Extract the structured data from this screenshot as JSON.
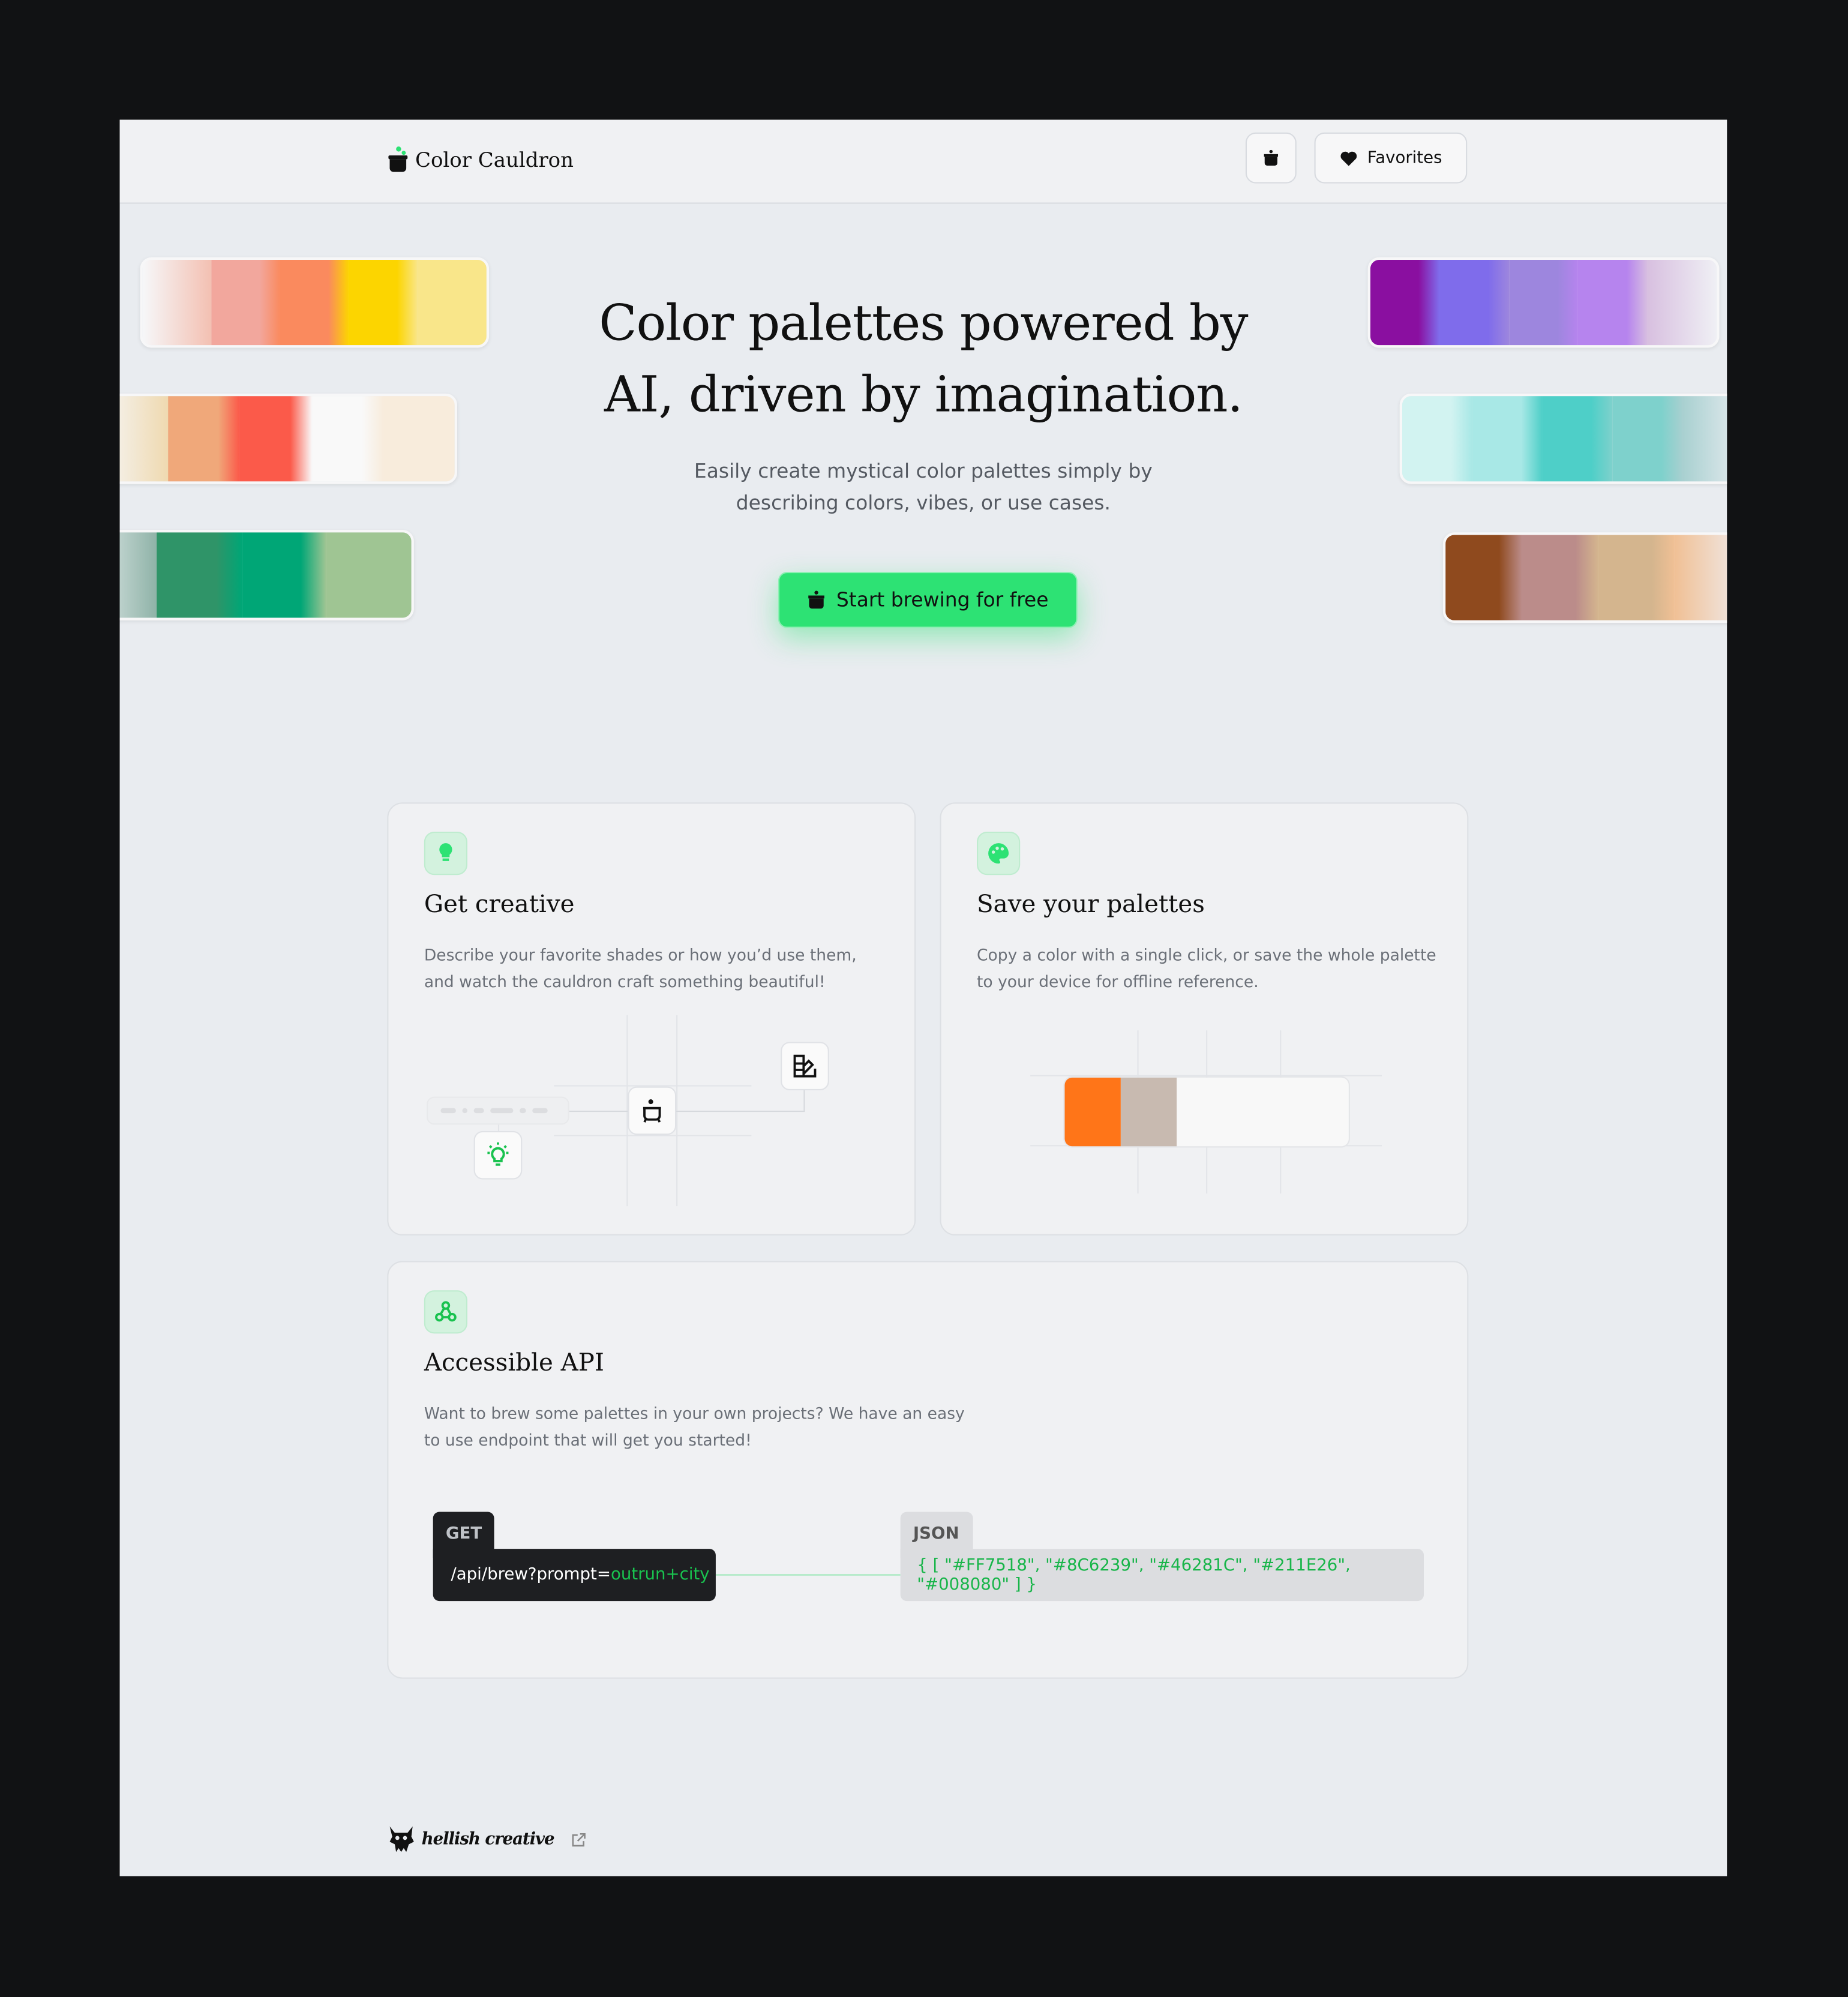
{
  "header": {
    "app_name": "Color Cauldron",
    "logo_icon": "cauldron-icon",
    "brew_button_icon": "cauldron-icon",
    "favorites_label": "Favorites",
    "favorites_icon": "heart-icon"
  },
  "palettes": {
    "left": [
      [
        "#f3c0b2",
        "#f2a79d",
        "#fa8a5e",
        "#fcd500",
        "#f9e68a"
      ],
      [
        "#efd9b0",
        "#f0a87a",
        "#fb5a4a",
        "#f9f9f9",
        "#f8ecdc"
      ],
      [
        "#8fb3a8",
        "#2f9468",
        "#00a676",
        "#9fc593"
      ]
    ],
    "right": [
      [
        "#8a0fa0",
        "#7f6ceb",
        "#9d86de",
        "#b684ee",
        "#d8c0e0"
      ],
      [
        "#d2f3f1",
        "#a8e8e6",
        "#4ecfc8",
        "#7ed1cc",
        "#a8d0d0"
      ],
      [
        "#8f4a1e",
        "#bb8c8a",
        "#d4b58e",
        "#f0c095"
      ]
    ]
  },
  "hero": {
    "title_line1": "Color palettes powered by",
    "title_line2": "AI, driven by imagination.",
    "subtitle_line1": "Easily create mystical color palettes simply by",
    "subtitle_line2": "describing colors, vibes, or use cases.",
    "cta_label": "Start brewing for free",
    "cta_color": "#2de274"
  },
  "features": [
    {
      "icon": "lightbulb-icon",
      "title": "Get creative",
      "desc_line1": "Describe your favorite shades or how you’d use them,",
      "desc_line2": "and watch the cauldron craft something beautiful!"
    },
    {
      "icon": "palette-icon",
      "title": "Save your palettes",
      "desc_line1": "Copy a color with a single click, or save the whole palette",
      "desc_line2": "to your device for offline reference.",
      "swatches": [
        "#ff7518",
        "#c8bab0",
        "#f8f8f8"
      ]
    },
    {
      "icon": "webhook-icon",
      "title": "Accessible API",
      "desc_line1": "Want to brew some palettes in your own projects? We have an easy",
      "desc_line2": "to use endpoint that will get you started!",
      "method": "GET",
      "endpoint": "/api/brew?prompt=",
      "prompt": "outrun+city",
      "response_label": "JSON",
      "response": "{ [ \"#FF7518\", \"#8C6239\", \"#46281C\", \"#211E26\", \"#008080\" ] }"
    }
  ],
  "footer": {
    "brand": "hellish creative",
    "link_icon": "external-link-icon"
  }
}
